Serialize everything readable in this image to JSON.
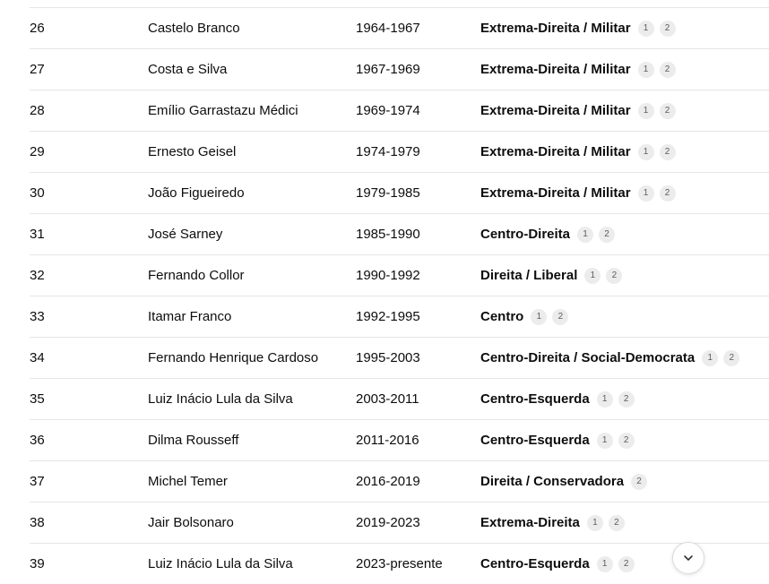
{
  "rows": [
    {
      "num": "26",
      "name": "Castelo Branco",
      "period": "1964-1967",
      "orientation": "Extrema-Direita / Militar",
      "citations": [
        "1",
        "2"
      ]
    },
    {
      "num": "27",
      "name": "Costa e Silva",
      "period": "1967-1969",
      "orientation": "Extrema-Direita / Militar",
      "citations": [
        "1",
        "2"
      ]
    },
    {
      "num": "28",
      "name": "Emílio Garrastazu Médici",
      "period": "1969-1974",
      "orientation": "Extrema-Direita / Militar",
      "citations": [
        "1",
        "2"
      ]
    },
    {
      "num": "29",
      "name": "Ernesto Geisel",
      "period": "1974-1979",
      "orientation": "Extrema-Direita / Militar",
      "citations": [
        "1",
        "2"
      ]
    },
    {
      "num": "30",
      "name": "João Figueiredo",
      "period": "1979-1985",
      "orientation": "Extrema-Direita / Militar",
      "citations": [
        "1",
        "2"
      ]
    },
    {
      "num": "31",
      "name": "José Sarney",
      "period": "1985-1990",
      "orientation": "Centro-Direita",
      "citations": [
        "1",
        "2"
      ]
    },
    {
      "num": "32",
      "name": "Fernando Collor",
      "period": "1990-1992",
      "orientation": "Direita / Liberal",
      "citations": [
        "1",
        "2"
      ]
    },
    {
      "num": "33",
      "name": "Itamar Franco",
      "period": "1992-1995",
      "orientation": "Centro",
      "citations": [
        "1",
        "2"
      ]
    },
    {
      "num": "34",
      "name": "Fernando Henrique Cardoso",
      "period": "1995-2003",
      "orientation": "Centro-Direita / Social-Democrata",
      "citations": [
        "1",
        "2"
      ]
    },
    {
      "num": "35",
      "name": "Luiz Inácio Lula da Silva",
      "period": "2003-2011",
      "orientation": "Centro-Esquerda",
      "citations": [
        "1",
        "2"
      ]
    },
    {
      "num": "36",
      "name": "Dilma Rousseff",
      "period": "2011-2016",
      "orientation": "Centro-Esquerda",
      "citations": [
        "1",
        "2"
      ]
    },
    {
      "num": "37",
      "name": "Michel Temer",
      "period": "2016-2019",
      "orientation": "Direita / Conservadora",
      "citations": [
        "2"
      ]
    },
    {
      "num": "38",
      "name": "Jair Bolsonaro",
      "period": "2019-2023",
      "orientation": "Extrema-Direita",
      "citations": [
        "1",
        "2"
      ]
    },
    {
      "num": "39",
      "name": "Luiz Inácio Lula da Silva",
      "period": "2023-presente",
      "orientation": "Centro-Esquerda",
      "citations": [
        "1",
        "2"
      ]
    }
  ],
  "scroll_button": {
    "icon": "chevron-down-icon"
  },
  "colors": {
    "text": "#0d0d0d",
    "divider": "#e5e5e5",
    "citation_bg": "#ececec",
    "citation_text": "#5d5d5d"
  }
}
